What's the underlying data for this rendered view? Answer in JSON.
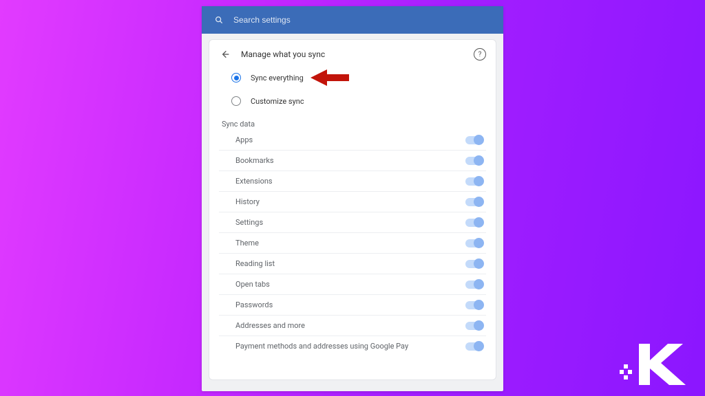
{
  "search": {
    "placeholder": "Search settings"
  },
  "header": {
    "title": "Manage what you sync"
  },
  "options": {
    "sync_everything": {
      "label": "Sync everything",
      "selected": true
    },
    "customize_sync": {
      "label": "Customize sync",
      "selected": false
    }
  },
  "section_label": "Sync data",
  "sync_items": [
    {
      "label": "Apps",
      "on": true
    },
    {
      "label": "Bookmarks",
      "on": true
    },
    {
      "label": "Extensions",
      "on": true
    },
    {
      "label": "History",
      "on": true
    },
    {
      "label": "Settings",
      "on": true
    },
    {
      "label": "Theme",
      "on": true
    },
    {
      "label": "Reading list",
      "on": true
    },
    {
      "label": "Open tabs",
      "on": true
    },
    {
      "label": "Passwords",
      "on": true
    },
    {
      "label": "Addresses and more",
      "on": true
    },
    {
      "label": "Payment methods and addresses using Google Pay",
      "on": true
    }
  ],
  "colors": {
    "accent": "#1a73e8",
    "header_bg": "#3b6cb8",
    "arrow": "#c2140a"
  }
}
